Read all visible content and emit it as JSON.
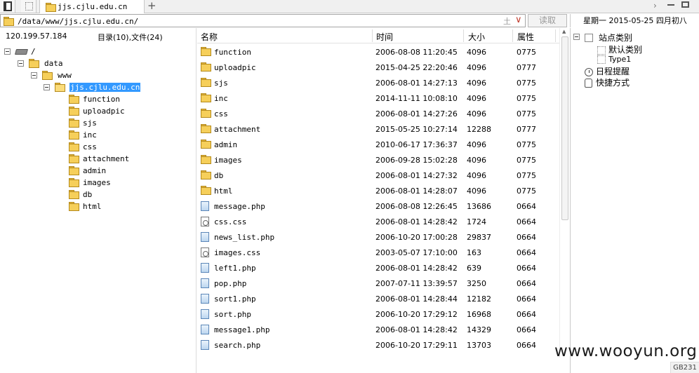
{
  "tab": {
    "title": "jjs.cjlu.edu.cn",
    "add_label": "+"
  },
  "address": {
    "path": "/data/www/jjs.cjlu.edu.cn/",
    "history_glyph": "土",
    "dropdown_glyph": "∨"
  },
  "read_button": "读取",
  "date": "星期一  2015-05-25  四月初八",
  "info": {
    "ip": "120.199.57.184",
    "count": "目录(10),文件(24)"
  },
  "tree": {
    "root": "/",
    "data": "data",
    "www": "www",
    "site": "jjs.cjlu.edu.cn",
    "children": [
      "function",
      "uploadpic",
      "sjs",
      "inc",
      "css",
      "attachment",
      "admin",
      "images",
      "db",
      "html"
    ]
  },
  "columns": {
    "name": "名称",
    "time": "时间",
    "size": "大小",
    "perm": "属性"
  },
  "files": [
    {
      "name": "function",
      "time": "2006-08-08 11:20:45",
      "size": "4096",
      "perm": "0775",
      "icon": "folder"
    },
    {
      "name": "uploadpic",
      "time": "2015-04-25 22:20:46",
      "size": "4096",
      "perm": "0777",
      "icon": "folder"
    },
    {
      "name": "sjs",
      "time": "2006-08-01 14:27:13",
      "size": "4096",
      "perm": "0775",
      "icon": "folder"
    },
    {
      "name": "inc",
      "time": "2014-11-11 10:08:10",
      "size": "4096",
      "perm": "0775",
      "icon": "folder"
    },
    {
      "name": "css",
      "time": "2006-08-01 14:27:26",
      "size": "4096",
      "perm": "0775",
      "icon": "folder"
    },
    {
      "name": "attachment",
      "time": "2015-05-25 10:27:14",
      "size": "12288",
      "perm": "0777",
      "icon": "folder"
    },
    {
      "name": "admin",
      "time": "2010-06-17 17:36:37",
      "size": "4096",
      "perm": "0775",
      "icon": "folder"
    },
    {
      "name": "images",
      "time": "2006-09-28 15:02:28",
      "size": "4096",
      "perm": "0775",
      "icon": "folder"
    },
    {
      "name": "db",
      "time": "2006-08-01 14:27:32",
      "size": "4096",
      "perm": "0775",
      "icon": "folder"
    },
    {
      "name": "html",
      "time": "2006-08-01 14:28:07",
      "size": "4096",
      "perm": "0775",
      "icon": "folder"
    },
    {
      "name": "message.php",
      "time": "2006-08-08 12:26:45",
      "size": "13686",
      "perm": "0664",
      "icon": "php"
    },
    {
      "name": "css.css",
      "time": "2006-08-01 14:28:42",
      "size": "1724",
      "perm": "0664",
      "icon": "css"
    },
    {
      "name": "news_list.php",
      "time": "2006-10-20 17:00:28",
      "size": "29837",
      "perm": "0664",
      "icon": "php"
    },
    {
      "name": "images.css",
      "time": "2003-05-07 17:10:00",
      "size": "163",
      "perm": "0664",
      "icon": "css"
    },
    {
      "name": "left1.php",
      "time": "2006-08-01 14:28:42",
      "size": "639",
      "perm": "0664",
      "icon": "php"
    },
    {
      "name": "pop.php",
      "time": "2007-07-11 13:39:57",
      "size": "3250",
      "perm": "0664",
      "icon": "php"
    },
    {
      "name": "sort1.php",
      "time": "2006-08-01 14:28:44",
      "size": "12182",
      "perm": "0664",
      "icon": "php"
    },
    {
      "name": "sort.php",
      "time": "2006-10-20 17:29:12",
      "size": "16968",
      "perm": "0664",
      "icon": "php"
    },
    {
      "name": "message1.php",
      "time": "2006-08-01 14:28:42",
      "size": "14329",
      "perm": "0664",
      "icon": "php"
    },
    {
      "name": "search.php",
      "time": "2006-10-20 17:29:11",
      "size": "13703",
      "perm": "0664",
      "icon": "php"
    }
  ],
  "right_panel": {
    "category": "站点类别",
    "default_category": "默认类别",
    "type1": "Type1",
    "schedule": "日程提醒",
    "shortcut": "快捷方式"
  },
  "watermark": "www.wooyun.org",
  "badge": "GB231"
}
